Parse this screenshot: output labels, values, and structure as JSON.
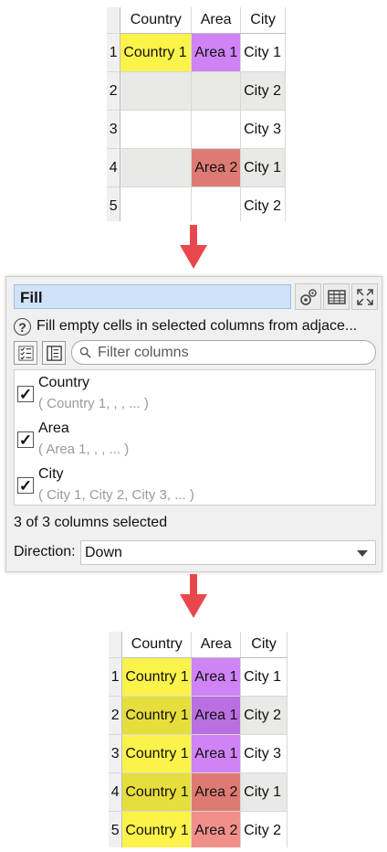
{
  "before_table": {
    "headers": [
      "Country",
      "Area",
      "City"
    ],
    "rows": [
      {
        "num": "1",
        "country": "Country 1",
        "area": "Area 1",
        "city": "City 1"
      },
      {
        "num": "2",
        "country": "",
        "area": "",
        "city": "City 2"
      },
      {
        "num": "3",
        "country": "",
        "area": "",
        "city": "City 3"
      },
      {
        "num": "4",
        "country": "",
        "area": "Area 2",
        "city": "City 1"
      },
      {
        "num": "5",
        "country": "",
        "area": "",
        "city": "City 2"
      }
    ]
  },
  "dialog": {
    "title": "Fill",
    "description": "Fill empty cells in selected columns from adjace...",
    "help_icon": "?",
    "search_placeholder": "Filter columns",
    "columns": [
      {
        "name": "Country",
        "sample": "( Country 1, , , ... )",
        "checked": true
      },
      {
        "name": "Area",
        "sample": "( Area 1, , , ... )",
        "checked": true
      },
      {
        "name": "City",
        "sample": "( City 1, City 2, City 3, ... )",
        "checked": true
      }
    ],
    "check_mark": "✓",
    "status": "3 of 3 columns selected",
    "direction_label": "Direction:",
    "direction_value": "Down",
    "icons": [
      "gears-icon",
      "table-icon",
      "expand-icon",
      "check-all-icon",
      "invert-selection-icon",
      "search-icon",
      "chevron-down-icon"
    ]
  },
  "after_table": {
    "headers": [
      "Country",
      "Area",
      "City"
    ],
    "rows": [
      {
        "num": "1",
        "country": "Country 1",
        "area": "Area 1",
        "city": "City 1"
      },
      {
        "num": "2",
        "country": "Country 1",
        "area": "Area 1",
        "city": "City 2"
      },
      {
        "num": "3",
        "country": "Country 1",
        "area": "Area 1",
        "city": "City 3"
      },
      {
        "num": "4",
        "country": "Country 1",
        "area": "Area 2",
        "city": "City 1"
      },
      {
        "num": "5",
        "country": "Country 1",
        "area": "Area 2",
        "city": "City 2"
      }
    ]
  },
  "colors": {
    "arrow": "#e8484d",
    "country_fill": "#fbf34a",
    "area1_fill": "#cf83f5",
    "area2_fill": "#f1908a",
    "title_bg": "#cfe2f7"
  }
}
